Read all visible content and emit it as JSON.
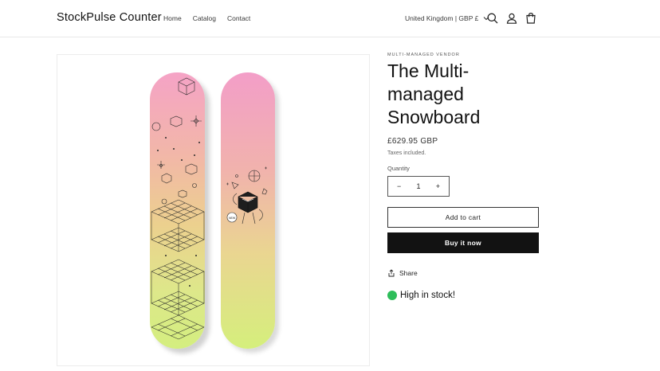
{
  "header": {
    "logo": "StockPulse Counter",
    "nav": [
      "Home",
      "Catalog",
      "Contact"
    ],
    "country": "United Kingdom | GBP £",
    "icons": [
      "search-icon",
      "account-icon",
      "cart-icon"
    ]
  },
  "product": {
    "vendor": "MULTI-MANAGED VENDOR",
    "title_line1": "The Multi-managed",
    "title_line2": "Snowboard",
    "price": "£629.95 GBP",
    "taxes": "Taxes included.",
    "quantity_label": "Quantity",
    "quantity": "1",
    "minus": "−",
    "plus": "+",
    "add_to_cart": "Add to cart",
    "buy_now": "Buy it now",
    "share": "Share",
    "stock": "High in stock!",
    "stock_color": "#2ebd5a"
  },
  "colors": {
    "text": "#121212",
    "buy_button_bg": "#121212",
    "border": "#e8e8e8"
  }
}
